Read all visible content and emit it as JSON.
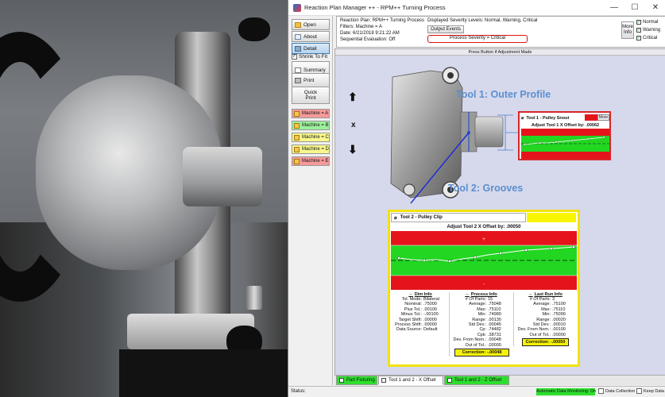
{
  "window": {
    "title": "Reaction Plan Manager ++ - RPM++ Turning Process",
    "minimize": "—",
    "maximize": "☐",
    "close": "✕"
  },
  "sidebar": {
    "buttons": [
      {
        "label": "Open",
        "icon": "folder-icon"
      },
      {
        "label": "About",
        "icon": "info-icon"
      },
      {
        "label": "Detail",
        "icon": "detail-icon"
      }
    ],
    "shrink_label": "Shrink To Fit",
    "shrink_checked": "✓",
    "summary_label": "Summary",
    "print_label": "Print",
    "quick_print_line1": "Quick",
    "quick_print_line2": "Print",
    "machines": [
      {
        "label": "Machine = A",
        "color": "#f59a9a"
      },
      {
        "label": "Machine = B",
        "color": "#9cf09c"
      },
      {
        "label": "Machine = C",
        "color": "#f7f78e"
      },
      {
        "label": "Machine = D",
        "color": "#f7f78e"
      },
      {
        "label": "Machine = E",
        "color": "#f59a9a"
      }
    ]
  },
  "header": {
    "line1": "Reaction Plan: RPM++ Turning Process",
    "line2": "Filters: Machine = A",
    "line3": "Date: 6/21/2018 9:21:22 AM",
    "line4": "Sequential Evaluation: Off",
    "severity_levels": "Displayed Severity Levels: Normal, Warning, Critical",
    "output_events": "Output Events",
    "process_severity": "Process Severity = Critical",
    "more_info_1": "More",
    "more_info_2": "Info",
    "checks": [
      {
        "label": "Normal",
        "mark": "✓"
      },
      {
        "label": "Warning",
        "mark": "✓"
      },
      {
        "label": "Critical",
        "mark": "✓"
      }
    ]
  },
  "main": {
    "banner": "Press Button if Adjustment Made",
    "tool1_label": "Tool 1: Outer Profile",
    "tool2_label": "Tool 2: Grooves",
    "up_arrow": "⬆",
    "down_arrow": "⬇",
    "x_axis_label": "x"
  },
  "tool1": {
    "name": "Tool 1 - Pulley Snout",
    "more": "More",
    "adjust": "Adjust Tool 1 X Offset by: .00062"
  },
  "tool2": {
    "name": "Tool 2 - Pulley Clip",
    "adjust": "Adjust Tool 2 X Offset by: .00050",
    "dim_info": {
      "title": "Dim Info",
      "rows": [
        {
          "k": "Tol. Mode:",
          "v": "Bilateral"
        },
        {
          "k": "Nominal:",
          "v": ".75000"
        },
        {
          "k": "Plus Tol.:",
          "v": ".00100"
        },
        {
          "k": "Minus Tol.:",
          "v": "-.00100"
        },
        {
          "k": "Target Shift:",
          "v": ".00000"
        },
        {
          "k": "Process Shift:",
          "v": ".00000"
        },
        {
          "k": "Data Source:",
          "v": "Default"
        }
      ]
    },
    "process_info": {
      "title": "Process Info",
      "rows": [
        {
          "k": "# Of Parts:",
          "v": "15"
        },
        {
          "k": "Average:",
          "v": ".75048"
        },
        {
          "k": "Max:",
          "v": ".75110"
        },
        {
          "k": "Min:",
          "v": ".74980"
        },
        {
          "k": "Range:",
          "v": ".00130"
        },
        {
          "k": "Std Dev.:",
          "v": ".00045"
        },
        {
          "k": "Cp:",
          "v": ".74482"
        },
        {
          "k": "Cpk:",
          "v": ".38731"
        },
        {
          "k": "Dev. From Nom.:",
          "v": ".00048"
        },
        {
          "k": "Out of Tol.:",
          "v": ".00000"
        }
      ],
      "correction": "Correction: -.00048"
    },
    "last_run_info": {
      "title": "Last Run Info",
      "rows": [
        {
          "k": "# Of Parts:",
          "v": "3"
        },
        {
          "k": "Average:",
          "v": ".75100"
        },
        {
          "k": "Max:",
          "v": ".75110"
        },
        {
          "k": "Min:",
          "v": ".75090"
        },
        {
          "k": "Range:",
          "v": ".00020"
        },
        {
          "k": "Std Dev.:",
          "v": ".00010"
        },
        {
          "k": "Dev. From Nom.:",
          "v": ".00100"
        },
        {
          "k": "Out of Tol.:",
          "v": ".00000"
        }
      ],
      "correction": "Correction: -.00050"
    }
  },
  "tabs": [
    {
      "label": "Part Fixturing",
      "style": "green"
    },
    {
      "label": "Tool 1 and 2 - X Offset",
      "style": "white"
    },
    {
      "label": "Tool 1 and 2 - Z Offset",
      "style": "green"
    }
  ],
  "status": {
    "label": "Status:",
    "auto_monitoring": "Automatic Data Monitoring: On",
    "data_collection": "Data Collection",
    "keep_data": "Keep Data"
  },
  "colors": {
    "critical_red": "#d8262a",
    "warning_yellow": "#f2e20d",
    "normal_green": "#2ede2e",
    "tool_label_blue": "#5b8fd0"
  }
}
